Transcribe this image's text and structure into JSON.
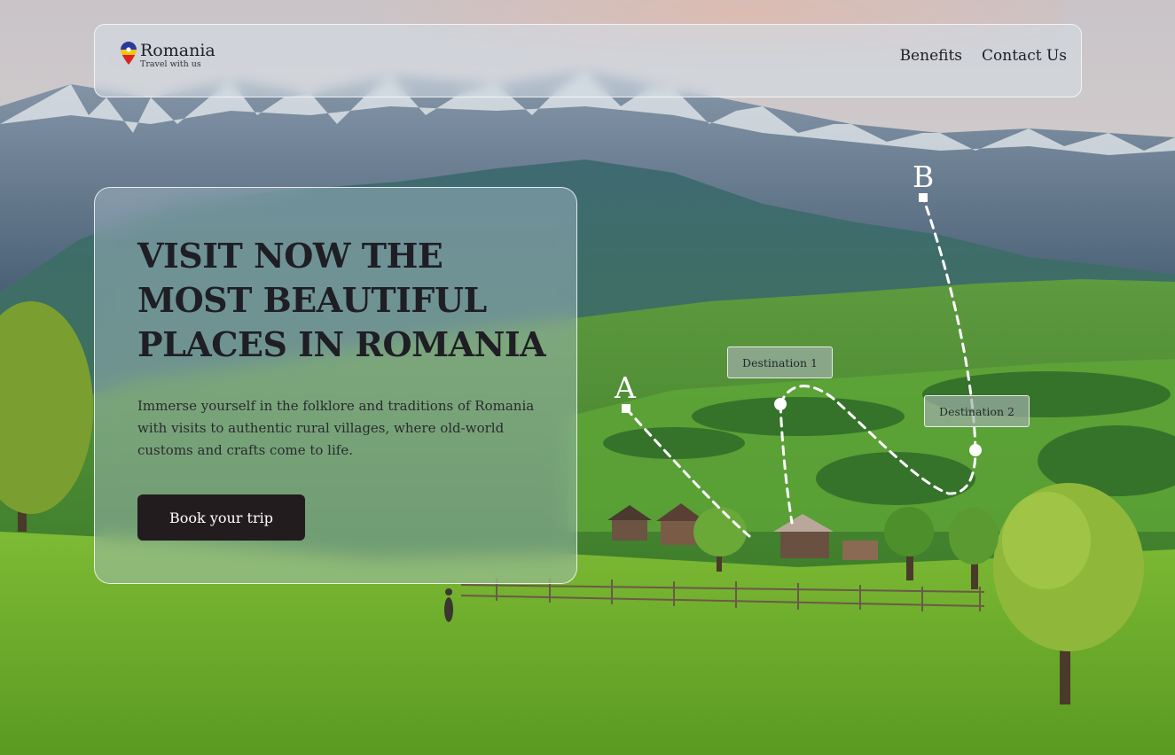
{
  "brand": {
    "name": "Romania",
    "tagline": "Travel with us"
  },
  "nav": {
    "items": [
      {
        "label": "Benefits"
      },
      {
        "label": "Contact Us"
      }
    ]
  },
  "hero": {
    "title": "VISIT NOW THE MOST BEAUTIFUL PLACES IN ROMANIA",
    "description": "Immerse yourself in the folklore and traditions of Romania with visits to authentic rural villages, where old-world customs and crafts come to life.",
    "cta_label": "Book your trip"
  },
  "route": {
    "start_label": "A",
    "end_label": "B",
    "stops": [
      {
        "label": "Destination 1"
      },
      {
        "label": "Destination 2"
      }
    ]
  },
  "colors": {
    "button": "#221c1e",
    "text": "#1e1e24",
    "grass": "#6fae2c",
    "sky": "#cfd8e0"
  },
  "icons": {
    "logo": "map-pin-icon"
  }
}
